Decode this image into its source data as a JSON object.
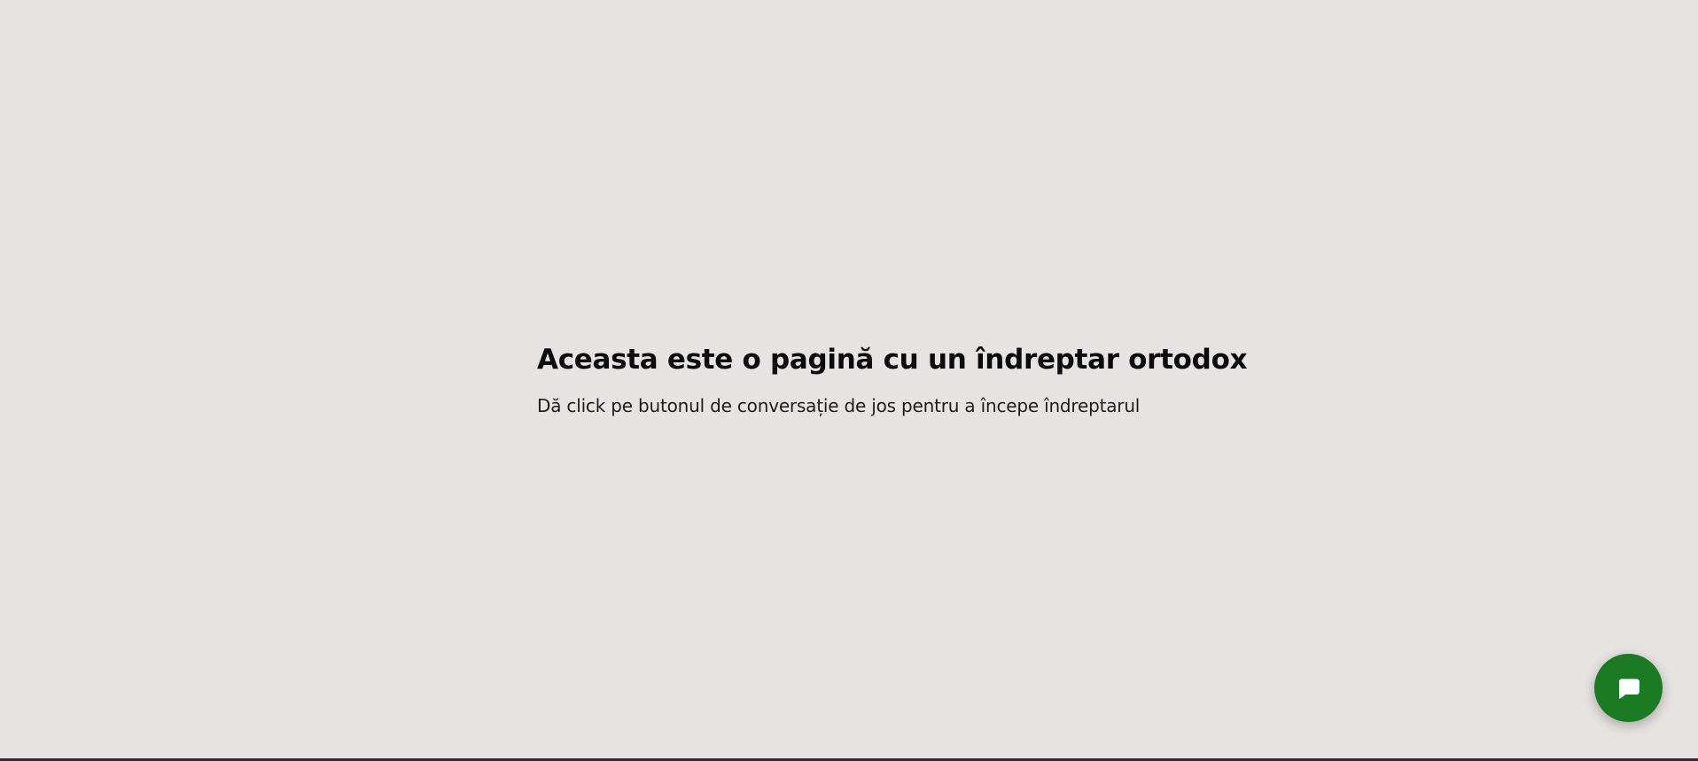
{
  "main": {
    "title": "Aceasta este o pagină cu un îndreptar ortodox",
    "subtitle": "Dă click pe butonul de conversație de jos pentru a începe îndreptarul"
  },
  "chat_button": {
    "icon": "chat-bubble-icon",
    "color": "#1b7b22"
  },
  "colors": {
    "background": "#e8e3e3",
    "accent": "#1b7b22"
  }
}
